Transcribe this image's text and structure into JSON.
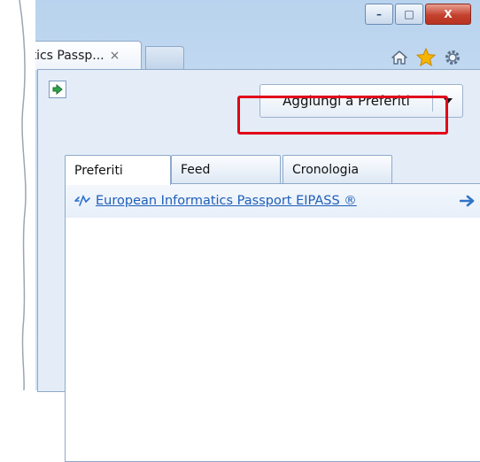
{
  "browser": {
    "tab": {
      "title": "atics Passp...",
      "close_glyph": "×"
    },
    "window_controls": {
      "minimize": "–",
      "maximize": "□",
      "close": "X"
    },
    "toolbar_icons": [
      "home-icon",
      "favorites-star-icon",
      "tools-gear-icon"
    ]
  },
  "favorites_center": {
    "add_button_label": "Aggiungi a Preferiti",
    "tabs": [
      {
        "label": "Preferiti",
        "active": true
      },
      {
        "label": "Feed",
        "active": false
      },
      {
        "label": "Cronologia",
        "active": false
      }
    ],
    "items": [
      {
        "label": "European Informatics Passport  EIPASS ®",
        "icon": "site-favicon-icon"
      }
    ]
  },
  "colors": {
    "highlight": "#e1001a",
    "link": "#1f5fb8",
    "frame": "#c6dbf1"
  }
}
